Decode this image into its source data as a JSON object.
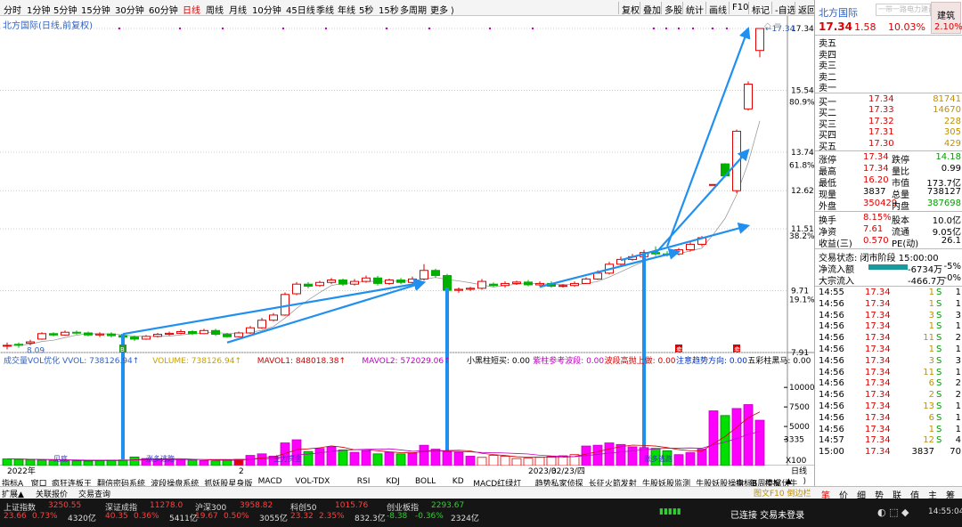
{
  "periods": [
    {
      "label": "分时",
      "active": false
    },
    {
      "label": "1分钟",
      "active": false
    },
    {
      "label": "5分钟",
      "active": false
    },
    {
      "label": "15分钟",
      "active": false
    },
    {
      "label": "30分钟",
      "active": false
    },
    {
      "label": "60分钟",
      "active": false
    },
    {
      "label": "日线",
      "active": true
    },
    {
      "label": "周线",
      "active": false
    },
    {
      "label": "月线",
      "active": false
    },
    {
      "label": "10分钟",
      "active": false
    },
    {
      "label": "45日线",
      "active": false
    },
    {
      "label": "季线",
      "active": false
    },
    {
      "label": "年线",
      "active": false
    },
    {
      "label": "5秒",
      "active": false
    },
    {
      "label": "15秒",
      "active": false
    },
    {
      "label": "多周期",
      "active": false
    },
    {
      "label": "更多 ⟩",
      "active": false
    }
  ],
  "toolbar_right": [
    "复权",
    "叠加",
    "多股",
    "统计",
    "画线",
    "F10",
    "标记",
    "-自选",
    "返回"
  ],
  "chart": {
    "stock_title": "北方国际(日线,前复权)",
    "price_axis": [
      {
        "v": 17.34,
        "l": "17.34"
      },
      {
        "v": 15.54,
        "l": "15.54"
      },
      {
        "v": 13.74,
        "l": "13.74"
      },
      {
        "v": 12.62,
        "l": "12.62"
      },
      {
        "v": 11.51,
        "l": "11.51"
      },
      {
        "v": 9.71,
        "l": "9.71"
      },
      {
        "v": 7.91,
        "l": "7.91"
      }
    ],
    "pct_axis": [
      {
        "v": 15.2,
        "l": "80.9%"
      },
      {
        "v": 13.36,
        "l": "61.8%"
      },
      {
        "v": 11.3,
        "l": "38.2%"
      },
      {
        "v": 9.45,
        "l": "19.1%"
      }
    ],
    "high_label": "17.34",
    "low_label": "8.09",
    "vol_header": [
      {
        "t": "成交量VOL优化  VVOL: 738126.94↑",
        "c": "#3060c0"
      },
      {
        "t": "VOLUME: 738126.94↑",
        "c": "#c8a000"
      },
      {
        "t": "MAVOL1: 848018.38↑",
        "c": "#d00000"
      },
      {
        "t": "MAVOL2: 572029.06↑",
        "c": "#c000c0"
      },
      {
        "t": "小黑柱短买: 0.00",
        "c": "#000000"
      },
      {
        "t": "紫柱参考波段: 0.00",
        "c": "#c000c0"
      },
      {
        "t": "波段高抛上做: 0.00",
        "c": "#d00000"
      },
      {
        "t": "注意趋势方向: 0.00",
        "c": "#0030c0"
      },
      {
        "t": "五彩柱黑马: 0.00",
        "c": "#000000"
      },
      {
        "t": "关键趋势顺上: 0.00",
        "c": "#d00000"
      }
    ],
    "vol_axis": [
      {
        "v": 10000,
        "l": "10000"
      },
      {
        "v": 7500,
        "l": "7500"
      },
      {
        "v": 5000,
        "l": "5000"
      },
      {
        "v": 3335,
        "l": "3335"
      }
    ],
    "vol_unit": "X100",
    "date_labels": [
      {
        "i": 0,
        "l": "2022年"
      },
      {
        "i": 20,
        "l": "2"
      },
      {
        "i": 45,
        "l": "2023/02/23/四"
      },
      {
        "i": 47,
        "l": "3"
      }
    ],
    "period_tag": "日线",
    "signal_labels": [
      "见底",
      "涨多逃跑",
      "主力资金",
      "涨多逃跑"
    ],
    "candles": [
      [
        8.1,
        8.12,
        8.0,
        8.2
      ],
      [
        8.15,
        8.12,
        8.05,
        8.2
      ],
      [
        8.18,
        8.22,
        8.12,
        8.28
      ],
      [
        8.3,
        8.46,
        8.28,
        8.5
      ],
      [
        8.46,
        8.42,
        8.38,
        8.5
      ],
      [
        8.42,
        8.5,
        8.4,
        8.55
      ],
      [
        8.5,
        8.48,
        8.43,
        8.55
      ],
      [
        8.48,
        8.42,
        8.38,
        8.52
      ],
      [
        8.42,
        8.45,
        8.36,
        8.5
      ],
      [
        8.45,
        8.4,
        8.35,
        8.5
      ],
      [
        8.4,
        8.36,
        8.3,
        8.45
      ],
      [
        8.36,
        8.3,
        8.25,
        8.4
      ],
      [
        8.3,
        8.38,
        8.28,
        8.42
      ],
      [
        8.38,
        8.44,
        8.35,
        8.48
      ],
      [
        8.44,
        8.47,
        8.4,
        8.52
      ],
      [
        8.47,
        8.52,
        8.44,
        8.58
      ],
      [
        8.52,
        8.46,
        8.42,
        8.56
      ],
      [
        8.46,
        8.55,
        8.44,
        8.6
      ],
      [
        8.55,
        8.44,
        8.4,
        8.6
      ],
      [
        8.44,
        8.37,
        8.34,
        8.48
      ],
      [
        8.37,
        8.48,
        8.35,
        8.52
      ],
      [
        8.48,
        8.63,
        8.45,
        8.68
      ],
      [
        8.63,
        8.85,
        8.6,
        8.92
      ],
      [
        8.85,
        9.0,
        8.82,
        9.06
      ],
      [
        9.0,
        9.6,
        8.98,
        9.66
      ],
      [
        9.62,
        9.9,
        9.58,
        9.96
      ],
      [
        9.9,
        9.84,
        9.78,
        9.96
      ],
      [
        9.86,
        9.95,
        9.82,
        10.0
      ],
      [
        9.95,
        10.02,
        9.9,
        10.08
      ],
      [
        10.02,
        9.9,
        9.85,
        10.06
      ],
      [
        9.9,
        9.98,
        9.86,
        10.05
      ],
      [
        9.98,
        10.08,
        9.94,
        10.15
      ],
      [
        10.08,
        9.92,
        9.86,
        10.14
      ],
      [
        9.92,
        10.02,
        9.88,
        10.06
      ],
      [
        10.02,
        9.95,
        9.9,
        10.08
      ],
      [
        9.95,
        10.05,
        9.9,
        10.12
      ],
      [
        10.05,
        10.3,
        10.0,
        10.48
      ],
      [
        10.3,
        10.15,
        10.08,
        10.35
      ],
      [
        10.15,
        9.72,
        9.68,
        10.2
      ],
      [
        9.72,
        9.75,
        9.65,
        9.8
      ],
      [
        9.75,
        9.78,
        9.7,
        9.82
      ],
      [
        9.78,
        9.98,
        9.74,
        10.05
      ],
      [
        9.9,
        9.86,
        9.82,
        9.95
      ],
      [
        9.86,
        9.92,
        9.8,
        9.98
      ],
      [
        9.92,
        9.96,
        9.88,
        10.0
      ],
      [
        9.96,
        9.88,
        9.84,
        10.02
      ],
      [
        9.88,
        9.92,
        9.82,
        9.98
      ],
      [
        9.92,
        9.84,
        9.8,
        9.98
      ],
      [
        9.84,
        9.86,
        9.8,
        9.9
      ],
      [
        9.86,
        9.92,
        9.82,
        9.98
      ],
      [
        9.92,
        10.05,
        9.9,
        10.1
      ],
      [
        10.05,
        10.22,
        10.02,
        10.3
      ],
      [
        10.22,
        10.48,
        10.18,
        10.55
      ],
      [
        10.48,
        10.62,
        10.45,
        10.7
      ],
      [
        10.62,
        10.7,
        10.58,
        10.78
      ],
      [
        10.7,
        10.82,
        10.65,
        10.9
      ],
      [
        10.82,
        10.78,
        10.72,
        11.0
      ],
      [
        10.78,
        10.76,
        10.7,
        10.86
      ],
      [
        10.78,
        10.9,
        10.74,
        10.95
      ],
      [
        10.9,
        11.06,
        10.85,
        11.12
      ],
      [
        11.06,
        11.25,
        11.0,
        11.3
      ],
      [
        12.8,
        12.8,
        12.8,
        12.8
      ],
      [
        13.4,
        13.05,
        13.0,
        13.42
      ],
      [
        12.62,
        14.35,
        12.55,
        14.4
      ],
      [
        15.0,
        15.72,
        14.95,
        15.8
      ],
      [
        16.7,
        17.34,
        16.5,
        17.34
      ]
    ],
    "volumes": [
      850,
      820,
      760,
      700,
      680,
      620,
      600,
      580,
      640,
      700,
      720,
      1100,
      900,
      850,
      820,
      760,
      700,
      640,
      600,
      700,
      800,
      1300,
      1500,
      1200,
      2900,
      3300,
      1800,
      2200,
      2400,
      2000,
      1700,
      1900,
      1500,
      1700,
      1500,
      1600,
      2600,
      2100,
      1800,
      1700,
      1200,
      1050,
      1300,
      1200,
      900,
      950,
      1050,
      1150,
      1250,
      1400,
      2500,
      2600,
      2900,
      2700,
      2400,
      2300,
      2200,
      1900,
      1400,
      1650,
      2100,
      7000,
      6400,
      7300,
      7800,
      5800
    ],
    "trend_labels": [
      "关键趋势向上"
    ],
    "markers": [
      {
        "i": 10,
        "txt": "B",
        "color": "#20a020"
      },
      {
        "i": 58,
        "txt": "卖",
        "color": "#d00"
      },
      {
        "i": 63,
        "txt": "卖",
        "color": "#d00"
      }
    ]
  },
  "quote": {
    "name": "北方国际",
    "price": "17.34",
    "change": "1.58",
    "pct": "10.03%",
    "search_placeholder": "一带一路电力建设龙头",
    "jianzhu_label": "建筑",
    "jianzhu_pct": "2.10%",
    "asks": [
      {
        "l": "卖五",
        "p": "",
        "v": ""
      },
      {
        "l": "卖四",
        "p": "",
        "v": ""
      },
      {
        "l": "卖三",
        "p": "",
        "v": ""
      },
      {
        "l": "卖二",
        "p": "",
        "v": ""
      },
      {
        "l": "卖一",
        "p": "",
        "v": ""
      }
    ],
    "bids": [
      {
        "l": "买一",
        "p": "17.34",
        "v": "81741"
      },
      {
        "l": "买二",
        "p": "17.33",
        "v": "14670"
      },
      {
        "l": "买三",
        "p": "17.32",
        "v": "228"
      },
      {
        "l": "买四",
        "p": "17.31",
        "v": "305"
      },
      {
        "l": "买五",
        "p": "17.30",
        "v": "429"
      }
    ],
    "stats": [
      [
        "涨停",
        "17.34",
        "跌停",
        "14.18"
      ],
      [
        "最高",
        "17.34",
        "量比",
        "0.99"
      ],
      [
        "最低",
        "16.20",
        "市值",
        "173.7亿"
      ],
      [
        "现量",
        "3837",
        "总量",
        "738127"
      ],
      [
        "外盘",
        "350429",
        "内盘",
        "387698"
      ]
    ],
    "stats2": [
      [
        "换手",
        "8.15%",
        "股本",
        "10.0亿"
      ],
      [
        "净资",
        "7.61",
        "流通",
        "9.05亿"
      ],
      [
        "收益(三)",
        "0.570",
        "PE(动)",
        "26.1"
      ]
    ],
    "status_label": "交易状态: 闭市阶段 15:00:00",
    "flows": [
      {
        "l": "净流入额",
        "v": "-6734万",
        "p": "-5%"
      },
      {
        "l": "大宗流入",
        "v": "-466.7万",
        "p": "-0%"
      }
    ],
    "ticks": [
      [
        "14:55",
        "17.34",
        "1",
        "S",
        "1"
      ],
      [
        "14:56",
        "17.34",
        "1",
        "S",
        "1"
      ],
      [
        "14:56",
        "17.34",
        "3",
        "S",
        "3"
      ],
      [
        "14:56",
        "17.34",
        "1",
        "S",
        "1"
      ],
      [
        "14:56",
        "17.34",
        "11",
        "S",
        "2"
      ],
      [
        "14:56",
        "17.34",
        "1",
        "S",
        "1"
      ],
      [
        "14:56",
        "17.34",
        "3",
        "S",
        "3"
      ],
      [
        "14:56",
        "17.34",
        "11",
        "S",
        "1"
      ],
      [
        "14:56",
        "17.34",
        "6",
        "S",
        "2"
      ],
      [
        "14:56",
        "17.34",
        "2",
        "S",
        "2"
      ],
      [
        "14:56",
        "17.34",
        "13",
        "S",
        "1"
      ],
      [
        "14:56",
        "17.34",
        "6",
        "S",
        "1"
      ],
      [
        "14:56",
        "17.34",
        "1",
        "S",
        "1"
      ],
      [
        "14:57",
        "17.34",
        "12",
        "S",
        "4"
      ],
      [
        "15:00",
        "17.34",
        "3837",
        "",
        "70"
      ]
    ]
  },
  "tabs_bottom_row1": [
    "指标A",
    "窗口",
    "疯狂连板王",
    "翻倍密码系统",
    "波段操盘系统",
    "抓妖股星身版",
    "MACD",
    "VOL-TDX",
    "RSI",
    "KDJ",
    "BOLL",
    "KD",
    "MACD红绿灯",
    "趋势私家侦探",
    "长征火箭发射",
    "牛股妖股监测",
    "牛股妖股操盘",
    "每周牛窝伏牛",
    "⟩",
    "指标B",
    "模板",
    "▲"
  ],
  "tabs_bottom_row2": [
    "扩展▲",
    "关联报价",
    "交易查询"
  ],
  "right_tabs": [
    "笔",
    "价",
    "细",
    "势",
    "联",
    "值",
    "主",
    "筹"
  ],
  "right_sub": "图文F10 倒边栏",
  "indices": [
    {
      "n": "上证指数",
      "v": "3250.55",
      "c": "23.66",
      "p": "0.73%",
      "a": "4320亿"
    },
    {
      "n": "深证成指",
      "v": "11278.0",
      "c": "40.35",
      "p": "0.36%",
      "a": "5411亿"
    },
    {
      "n": "沪深300",
      "v": "3958.82",
      "c": "19.67",
      "p": "0.50%",
      "a": "3055亿"
    },
    {
      "n": "科创50",
      "v": "1015.76",
      "c": "23.32",
      "p": "2.35%",
      "a": "832.3亿"
    },
    {
      "n": "创业板指",
      "v": "2293.67",
      "c": "-8.38",
      "p": "-0.36%",
      "a": "2324亿"
    }
  ],
  "status_conn": "已连接 交易未登录",
  "clock": "14:55:04"
}
